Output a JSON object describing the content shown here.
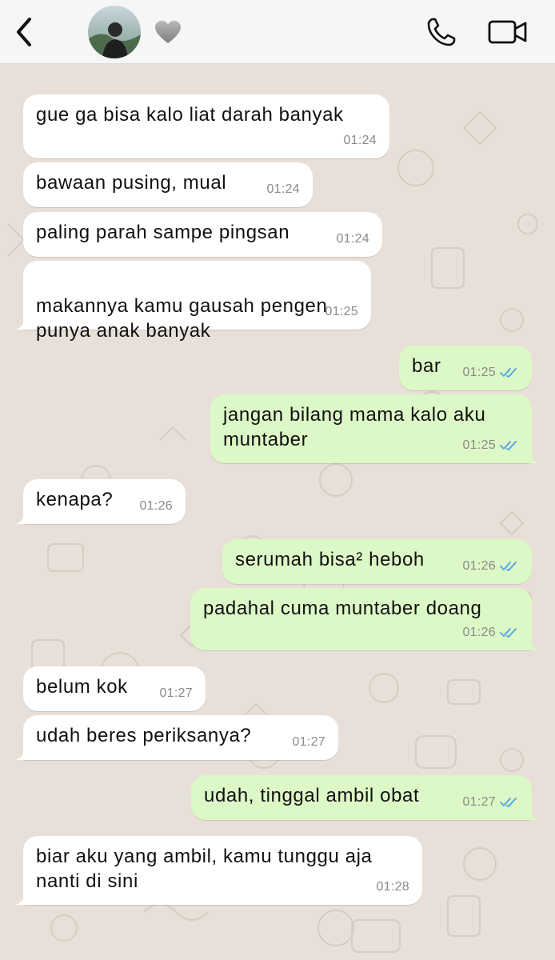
{
  "header": {
    "back_icon": "chevron-left-icon",
    "avatar": "contact-avatar",
    "heart_icon": "grey-heart-icon",
    "call_icon": "phone-icon",
    "video_icon": "video-camera-icon"
  },
  "colors": {
    "chat_bg": "#e8e0d8",
    "incoming_bubble": "#ffffff",
    "outgoing_bubble": "#dcf8c6",
    "read_ticks": "#4fa3e8"
  },
  "messages": [
    {
      "text": "gue ga bisa kalo liat darah banyak",
      "time": "01:24"
    },
    {
      "text": "bawaan pusing, mual",
      "time": "01:24"
    },
    {
      "text": "paling parah sampe pingsan",
      "time": "01:24"
    },
    {
      "text": "makannya kamu gausah pengen\npunya anak banyak",
      "time": "01:25"
    },
    {
      "text": "bar",
      "time": "01:25"
    },
    {
      "text": "jangan bilang mama kalo aku\nmuntaber",
      "time": "01:25"
    },
    {
      "text": "kenapa?",
      "time": "01:26"
    },
    {
      "text": "serumah bisa² heboh",
      "time": "01:26"
    },
    {
      "text": "padahal cuma muntaber doang",
      "time": "01:26"
    },
    {
      "text": "belum kok",
      "time": "01:27"
    },
    {
      "text": "udah beres periksanya?",
      "time": "01:27"
    },
    {
      "text": "udah, tinggal ambil obat",
      "time": "01:27"
    },
    {
      "text": "biar aku yang ambil, kamu tunggu aja\nnanti di sini",
      "time": "01:28"
    }
  ]
}
